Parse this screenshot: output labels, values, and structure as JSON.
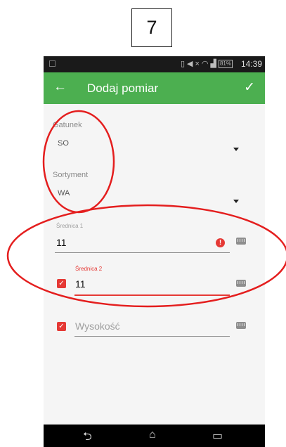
{
  "step_number": "7",
  "status_bar": {
    "battery": "81%",
    "time": "14:39",
    "icons": [
      "vibrate-icon",
      "mute-icon",
      "wifi-icon",
      "signal-icon"
    ]
  },
  "app_bar": {
    "title": "Dodaj pomiar",
    "back_icon": "←",
    "confirm_icon": "✓",
    "color": "#4caf50"
  },
  "form": {
    "gatunek": {
      "label": "Gatunek",
      "value": "SO"
    },
    "sortyment": {
      "label": "Sortyment",
      "value": "WA"
    },
    "srednica1": {
      "label": "Średnica 1",
      "value": "11",
      "error_icon": "!"
    },
    "srednica2": {
      "label": "Średnica 2",
      "value": "11",
      "checked": true
    },
    "wysokosc": {
      "placeholder": "Wysokość",
      "checked": true
    }
  },
  "nav_bar": {
    "back": "⮌",
    "home": "⌂",
    "recents": "▭"
  },
  "annotation_color": "#e41e1e",
  "error_color": "#e53935"
}
